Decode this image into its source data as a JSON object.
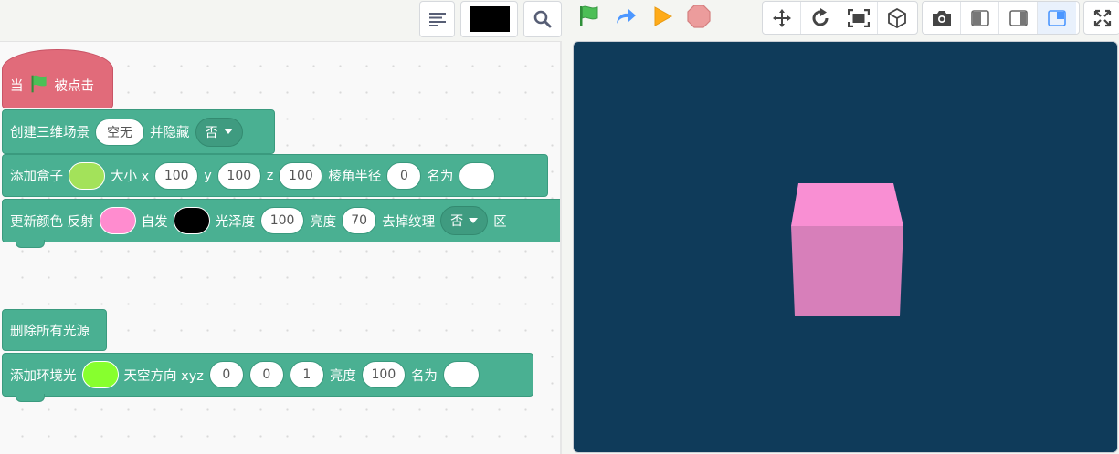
{
  "toolbar": {
    "icons": [
      "list-icon",
      "color-swatch",
      "search-icon",
      "green-flag-icon",
      "redo-arrow-icon",
      "play-icon",
      "stop-icon",
      "move-icon",
      "rotate-icon",
      "fit-screen-icon",
      "cube-icon",
      "camera-icon",
      "layout-left-icon",
      "layout-right-icon",
      "layout-small-icon",
      "fullscreen-icon"
    ],
    "swatch_color": "#000000",
    "flag_color": "#4cbf56",
    "play_color": "#ffab19",
    "stop_color": "#ec9c9c",
    "accent": "#4c97ff"
  },
  "blocks": {
    "hat": {
      "when": "当",
      "clicked": "被点击"
    },
    "create_scene": {
      "label": "创建三维场景",
      "value": "空无",
      "hide_label": "并隐藏",
      "hide_value": "否"
    },
    "add_box": {
      "label": "添加盒子",
      "color": "#a3e25a",
      "size_label": "大小 x",
      "x": "100",
      "y_label": "y",
      "y": "100",
      "z_label": "z",
      "z": "100",
      "radius_label": "棱角半径",
      "radius": "0",
      "name_label": "名为",
      "name": ""
    },
    "update_color": {
      "label": "更新颜色 反射",
      "reflect_color": "#ff8ccf",
      "emissive_label": "自发",
      "emissive_color": "#000000",
      "gloss_label": "光泽度",
      "gloss": "100",
      "bright_label": "亮度",
      "bright": "70",
      "texture_label": "去掉纹理",
      "texture": "否",
      "tail": "区"
    },
    "remove_lights": {
      "label": "删除所有光源"
    },
    "add_ambient": {
      "label": "添加环境光",
      "color": "#87ff2e",
      "dir_label": "天空方向 xyz",
      "dx": "0",
      "dy": "0",
      "dz": "1",
      "bright_label": "亮度",
      "bright": "100",
      "name_label": "名为",
      "name": ""
    }
  },
  "stage": {
    "background": "#0f3b5a",
    "cube_color": "#ff8ccf"
  }
}
